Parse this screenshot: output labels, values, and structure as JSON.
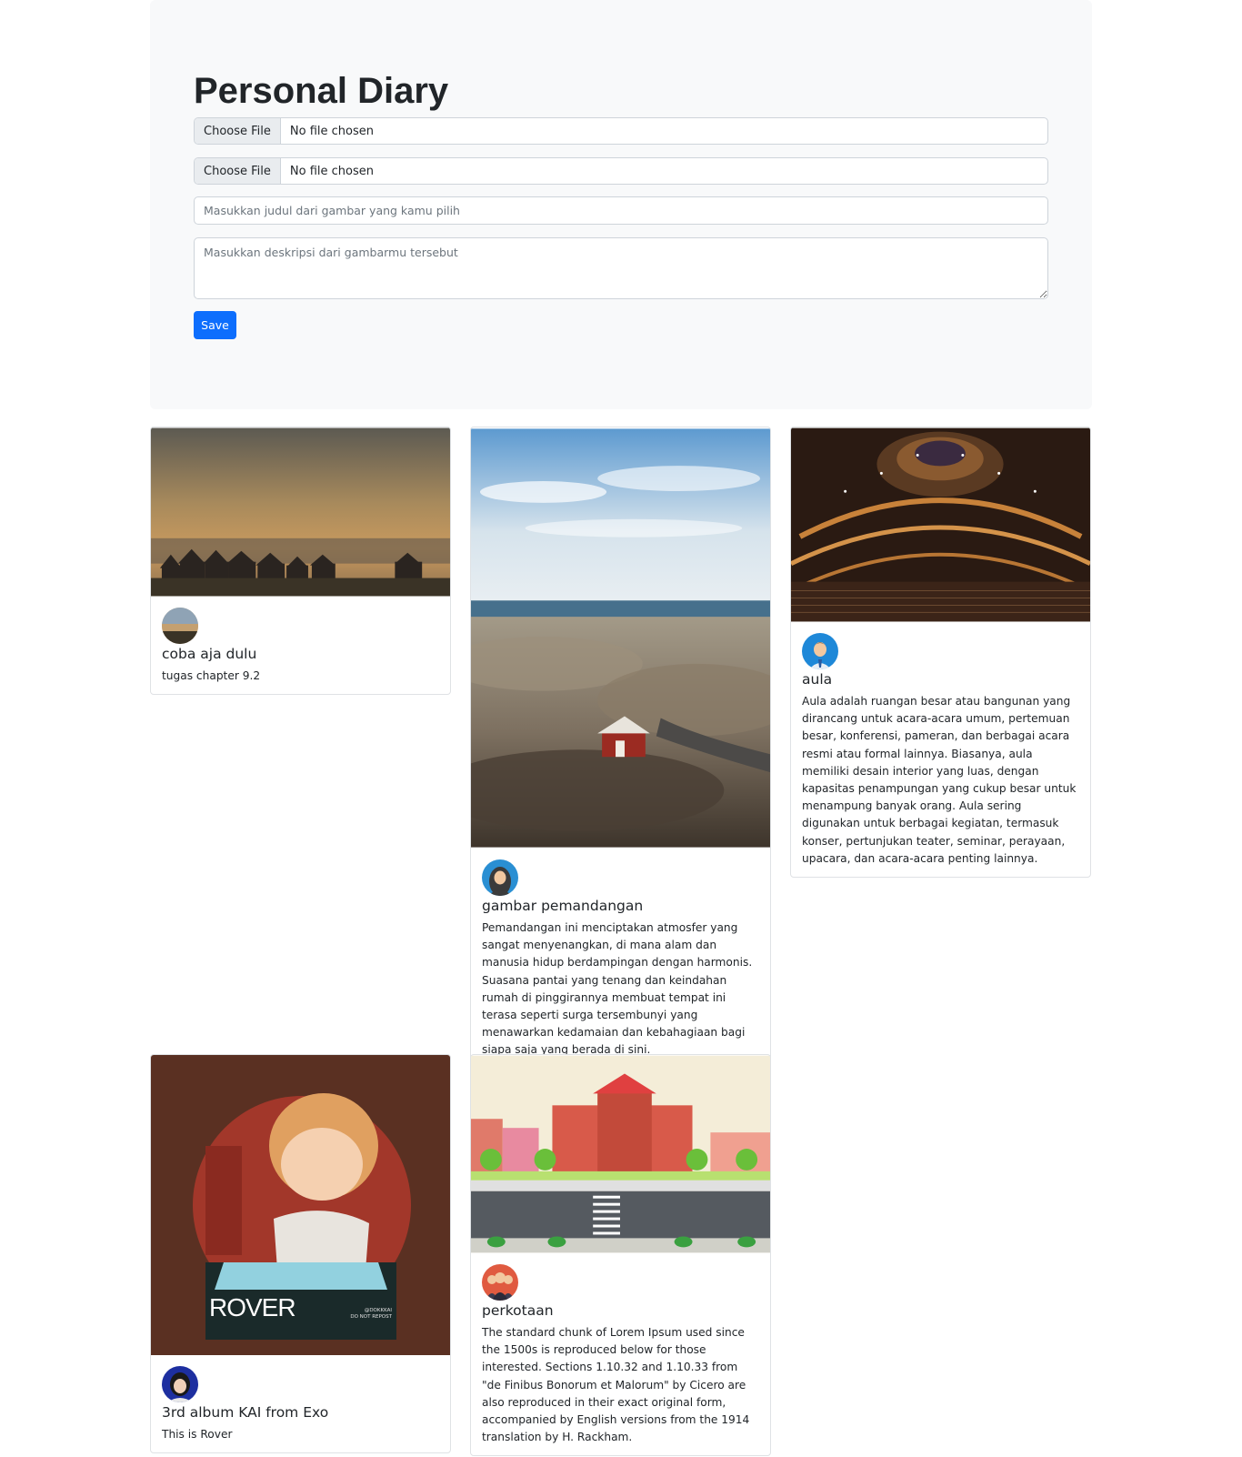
{
  "page": {
    "title": "Personal Diary"
  },
  "form": {
    "file1": {
      "button_label": "Choose File",
      "status": "No file chosen"
    },
    "file2": {
      "button_label": "Choose File",
      "status": "No file chosen"
    },
    "title_input": {
      "placeholder": "Masukkan judul dari gambar yang kamu pilih",
      "value": ""
    },
    "description_input": {
      "placeholder": "Masukkan deskripsi dari gambarmu tersebut",
      "value": ""
    },
    "save_label": "Save"
  },
  "colors": {
    "primary": "#0d6efd",
    "jumbotron_bg": "#f8f9fa",
    "border": "#ced4da"
  },
  "cards": [
    {
      "image": "coastal-village-sunset",
      "avatar": "landscape-avatar",
      "title": "coba aja dulu",
      "text": "tugas chapter 9.2"
    },
    {
      "image": "rocky-coast-red-house",
      "avatar": "hijab-woman-avatar",
      "title": "gambar pemandangan",
      "text": "Pemandangan ini menciptakan atmosfer yang sangat menyenangkan, di mana alam dan manusia hidup berdampingan dengan harmonis. Suasana pantai yang tenang dan keindahan rumah di pinggirannya membuat tempat ini terasa seperti surga tersembunyi yang menawarkan kedamaian dan kebahagiaan bagi siapa saja yang berada di sini."
    },
    {
      "image": "concert-hall-interior",
      "avatar": "businessman-avatar",
      "title": "aula",
      "text": "Aula adalah ruangan besar atau bangunan yang dirancang untuk acara-acara umum, pertemuan besar, konferensi, pameran, dan berbagai acara resmi atau formal lainnya. Biasanya, aula memiliki desain interior yang luas, dengan kapasitas penampungan yang cukup besar untuk menampung banyak orang. Aula sering digunakan untuk berbagai kegiatan, termasuk konser, pertunjukan teater, seminar, perayaan, upacara, dan acara-acara penting lainnya."
    },
    {
      "image": "rover-album-illustration",
      "image_text": "ROVER",
      "image_watermark": "@DOKKKAI\nDO NOT REPOST",
      "avatar": "person-photo-avatar",
      "title": "3rd album KAI from Exo",
      "text": "This is Rover"
    },
    {
      "image": "city-street-illustration",
      "avatar": "group-people-avatar",
      "title": "perkotaan",
      "text": "The standard chunk of Lorem Ipsum used since the 1500s is reproduced below for those interested. Sections 1.10.32 and 1.10.33 from \"de Finibus Bonorum et Malorum\" by Cicero are also reproduced in their exact original form, accompanied by English versions from the 1914 translation by H. Rackham."
    }
  ]
}
